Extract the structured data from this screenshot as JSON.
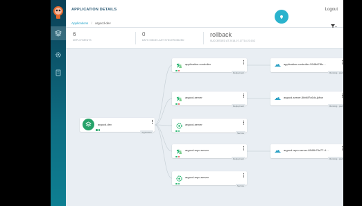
{
  "header": {
    "title": "APPLICATION DETAILS",
    "logout": "Logout",
    "breadcrumb": {
      "root": "Applications",
      "separator": "/",
      "current": "argocd-dev"
    }
  },
  "status": {
    "deployments": {
      "value": "6",
      "label": "DEPLOYMENTS"
    },
    "last_synced": {
      "value": "0",
      "label": "DAYS SINCE LAST SYNCHRONIZED"
    },
    "operation": {
      "value": "rollback",
      "label": "SUCCEEDED AT 2018-07-17T14:23:15Z"
    }
  },
  "app_node": {
    "name": "argocd-dev",
    "tag": "Application"
  },
  "resources": [
    {
      "name": "application-controller",
      "tag": "Deployment",
      "icon": "deployment-icon",
      "status": [
        "#2bb673",
        "#e94b4b"
      ]
    },
    {
      "name": "argocd-server",
      "tag": "Deployment",
      "icon": "deployment-icon",
      "status": [
        "#2bb673",
        "#e94b4b"
      ]
    },
    {
      "name": "argocd-server",
      "tag": "Service",
      "icon": "service-icon",
      "status": [
        "#2bb673",
        "#2bb673"
      ]
    },
    {
      "name": "argocd-repo-server",
      "tag": "Deployment",
      "icon": "deployment-icon",
      "status": [
        "#2bb673",
        "#e94b4b"
      ]
    },
    {
      "name": "argocd-repo-server",
      "tag": "Service",
      "icon": "service-icon",
      "status": [
        "#2bb673",
        "#2bb673"
      ]
    }
  ],
  "replicasets": [
    {
      "name": "application-controller-5948d7f8c…",
      "tag": "Running · pod",
      "icon": "replicaset-icon"
    },
    {
      "name": "argocd-server-5bb6f7c6dc-jkfvw",
      "tag": "Running · pod",
      "icon": "replicaset-icon"
    },
    {
      "name": "argocd-repo-server-8949b76c77-4…",
      "tag": "Running · pod",
      "icon": "replicaset-icon"
    }
  ],
  "colors": {
    "accent": "#2ab3cd",
    "sidebar": "#0e6d82",
    "healthy": "#27a36a",
    "title": "#2b5a75"
  }
}
